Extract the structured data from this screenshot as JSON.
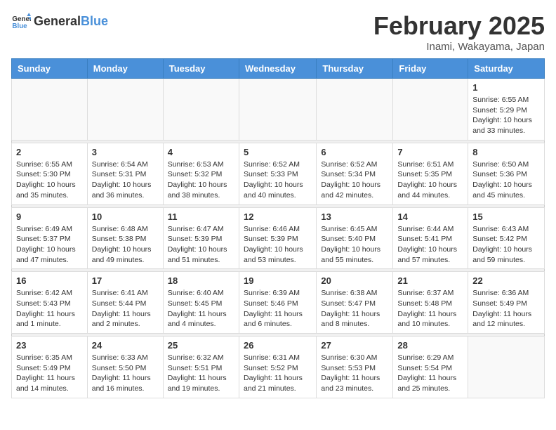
{
  "header": {
    "logo_general": "General",
    "logo_blue": "Blue",
    "title": "February 2025",
    "subtitle": "Inami, Wakayama, Japan"
  },
  "weekdays": [
    "Sunday",
    "Monday",
    "Tuesday",
    "Wednesday",
    "Thursday",
    "Friday",
    "Saturday"
  ],
  "weeks": [
    [
      {
        "day": "",
        "detail": ""
      },
      {
        "day": "",
        "detail": ""
      },
      {
        "day": "",
        "detail": ""
      },
      {
        "day": "",
        "detail": ""
      },
      {
        "day": "",
        "detail": ""
      },
      {
        "day": "",
        "detail": ""
      },
      {
        "day": "1",
        "detail": "Sunrise: 6:55 AM\nSunset: 5:29 PM\nDaylight: 10 hours\nand 33 minutes."
      }
    ],
    [
      {
        "day": "2",
        "detail": "Sunrise: 6:55 AM\nSunset: 5:30 PM\nDaylight: 10 hours\nand 35 minutes."
      },
      {
        "day": "3",
        "detail": "Sunrise: 6:54 AM\nSunset: 5:31 PM\nDaylight: 10 hours\nand 36 minutes."
      },
      {
        "day": "4",
        "detail": "Sunrise: 6:53 AM\nSunset: 5:32 PM\nDaylight: 10 hours\nand 38 minutes."
      },
      {
        "day": "5",
        "detail": "Sunrise: 6:52 AM\nSunset: 5:33 PM\nDaylight: 10 hours\nand 40 minutes."
      },
      {
        "day": "6",
        "detail": "Sunrise: 6:52 AM\nSunset: 5:34 PM\nDaylight: 10 hours\nand 42 minutes."
      },
      {
        "day": "7",
        "detail": "Sunrise: 6:51 AM\nSunset: 5:35 PM\nDaylight: 10 hours\nand 44 minutes."
      },
      {
        "day": "8",
        "detail": "Sunrise: 6:50 AM\nSunset: 5:36 PM\nDaylight: 10 hours\nand 45 minutes."
      }
    ],
    [
      {
        "day": "9",
        "detail": "Sunrise: 6:49 AM\nSunset: 5:37 PM\nDaylight: 10 hours\nand 47 minutes."
      },
      {
        "day": "10",
        "detail": "Sunrise: 6:48 AM\nSunset: 5:38 PM\nDaylight: 10 hours\nand 49 minutes."
      },
      {
        "day": "11",
        "detail": "Sunrise: 6:47 AM\nSunset: 5:39 PM\nDaylight: 10 hours\nand 51 minutes."
      },
      {
        "day": "12",
        "detail": "Sunrise: 6:46 AM\nSunset: 5:39 PM\nDaylight: 10 hours\nand 53 minutes."
      },
      {
        "day": "13",
        "detail": "Sunrise: 6:45 AM\nSunset: 5:40 PM\nDaylight: 10 hours\nand 55 minutes."
      },
      {
        "day": "14",
        "detail": "Sunrise: 6:44 AM\nSunset: 5:41 PM\nDaylight: 10 hours\nand 57 minutes."
      },
      {
        "day": "15",
        "detail": "Sunrise: 6:43 AM\nSunset: 5:42 PM\nDaylight: 10 hours\nand 59 minutes."
      }
    ],
    [
      {
        "day": "16",
        "detail": "Sunrise: 6:42 AM\nSunset: 5:43 PM\nDaylight: 11 hours\nand 1 minute."
      },
      {
        "day": "17",
        "detail": "Sunrise: 6:41 AM\nSunset: 5:44 PM\nDaylight: 11 hours\nand 2 minutes."
      },
      {
        "day": "18",
        "detail": "Sunrise: 6:40 AM\nSunset: 5:45 PM\nDaylight: 11 hours\nand 4 minutes."
      },
      {
        "day": "19",
        "detail": "Sunrise: 6:39 AM\nSunset: 5:46 PM\nDaylight: 11 hours\nand 6 minutes."
      },
      {
        "day": "20",
        "detail": "Sunrise: 6:38 AM\nSunset: 5:47 PM\nDaylight: 11 hours\nand 8 minutes."
      },
      {
        "day": "21",
        "detail": "Sunrise: 6:37 AM\nSunset: 5:48 PM\nDaylight: 11 hours\nand 10 minutes."
      },
      {
        "day": "22",
        "detail": "Sunrise: 6:36 AM\nSunset: 5:49 PM\nDaylight: 11 hours\nand 12 minutes."
      }
    ],
    [
      {
        "day": "23",
        "detail": "Sunrise: 6:35 AM\nSunset: 5:49 PM\nDaylight: 11 hours\nand 14 minutes."
      },
      {
        "day": "24",
        "detail": "Sunrise: 6:33 AM\nSunset: 5:50 PM\nDaylight: 11 hours\nand 16 minutes."
      },
      {
        "day": "25",
        "detail": "Sunrise: 6:32 AM\nSunset: 5:51 PM\nDaylight: 11 hours\nand 19 minutes."
      },
      {
        "day": "26",
        "detail": "Sunrise: 6:31 AM\nSunset: 5:52 PM\nDaylight: 11 hours\nand 21 minutes."
      },
      {
        "day": "27",
        "detail": "Sunrise: 6:30 AM\nSunset: 5:53 PM\nDaylight: 11 hours\nand 23 minutes."
      },
      {
        "day": "28",
        "detail": "Sunrise: 6:29 AM\nSunset: 5:54 PM\nDaylight: 11 hours\nand 25 minutes."
      },
      {
        "day": "",
        "detail": ""
      }
    ]
  ]
}
